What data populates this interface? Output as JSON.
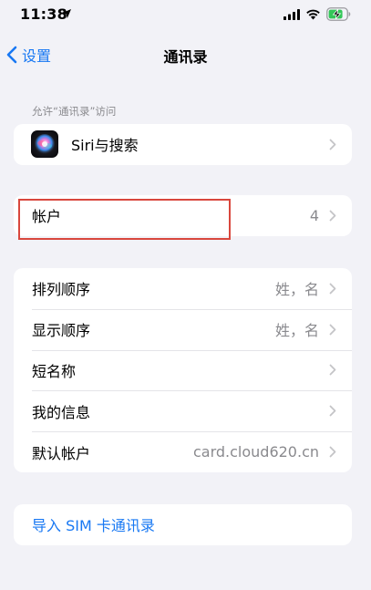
{
  "status_bar": {
    "time": "11:38",
    "icons": [
      "location-arrow-icon",
      "signal-icon",
      "wifi-icon",
      "battery-charging-icon"
    ]
  },
  "nav": {
    "back_label": "设置",
    "title": "通讯录"
  },
  "siri_section": {
    "header": "允许“通讯录”访问",
    "item_label": "Siri与搜索"
  },
  "accounts": {
    "label": "帐户",
    "value": "4"
  },
  "settings_group": {
    "items": [
      {
        "label": "排列顺序",
        "value": "姓，名"
      },
      {
        "label": "显示顺序",
        "value": "姓，名"
      },
      {
        "label": "短名称",
        "value": ""
      },
      {
        "label": "我的信息",
        "value": ""
      },
      {
        "label": "默认帐户",
        "value": "card.cloud620.cn"
      }
    ]
  },
  "import_sim": {
    "label": "导入 SIM 卡通讯录"
  },
  "colors": {
    "background": "#f2f2f7",
    "accent": "#1878f3",
    "secondary_text": "#8a8a8e",
    "highlight": "#d9473d"
  }
}
